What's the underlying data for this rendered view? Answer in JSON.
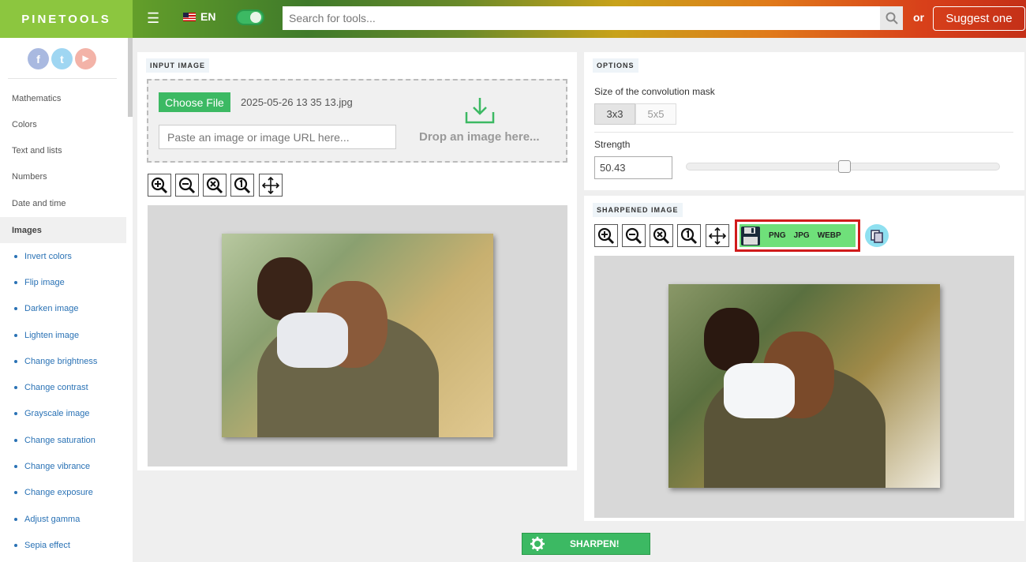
{
  "header": {
    "logo": "PINETOOLS",
    "lang": "EN",
    "search_placeholder": "Search for tools...",
    "or": "or",
    "suggest": "Suggest one"
  },
  "sidebar": {
    "social": [
      "f",
      "t",
      "▶"
    ],
    "categories": [
      "Mathematics",
      "Colors",
      "Text and lists",
      "Numbers",
      "Date and time",
      "Images"
    ],
    "subitems": [
      "Invert colors",
      "Flip image",
      "Darken image",
      "Lighten image",
      "Change brightness",
      "Change contrast",
      "Grayscale image",
      "Change saturation",
      "Change vibrance",
      "Change exposure",
      "Adjust gamma",
      "Sepia effect"
    ]
  },
  "input": {
    "title": "INPUT IMAGE",
    "choose": "Choose File",
    "filename": "2025-05-26 13 35 13.jpg",
    "paste_placeholder": "Paste an image or image URL here...",
    "drop": "Drop an image here..."
  },
  "options": {
    "title": "OPTIONS",
    "mask_label": "Size of the convolution mask",
    "mask_3": "3x3",
    "mask_5": "5x5",
    "strength_label": "Strength",
    "strength_value": "50.43"
  },
  "sharpened": {
    "title": "SHARPENED IMAGE",
    "png": "PNG",
    "jpg": "JPG",
    "webp": "WEBP"
  },
  "sharpen_btn": "SHARPEN!",
  "colors": {
    "green": "#3cb963",
    "highlight": "#d01b1b",
    "logo": "#8cc63f"
  },
  "icons": [
    "menu-icon",
    "flag-icon",
    "search-icon",
    "zoom-in-icon",
    "zoom-out-icon",
    "zoom-reset-icon",
    "zoom-fit-icon",
    "move-icon",
    "download-icon",
    "floppy-icon",
    "copy-icon",
    "gear-icon"
  ]
}
